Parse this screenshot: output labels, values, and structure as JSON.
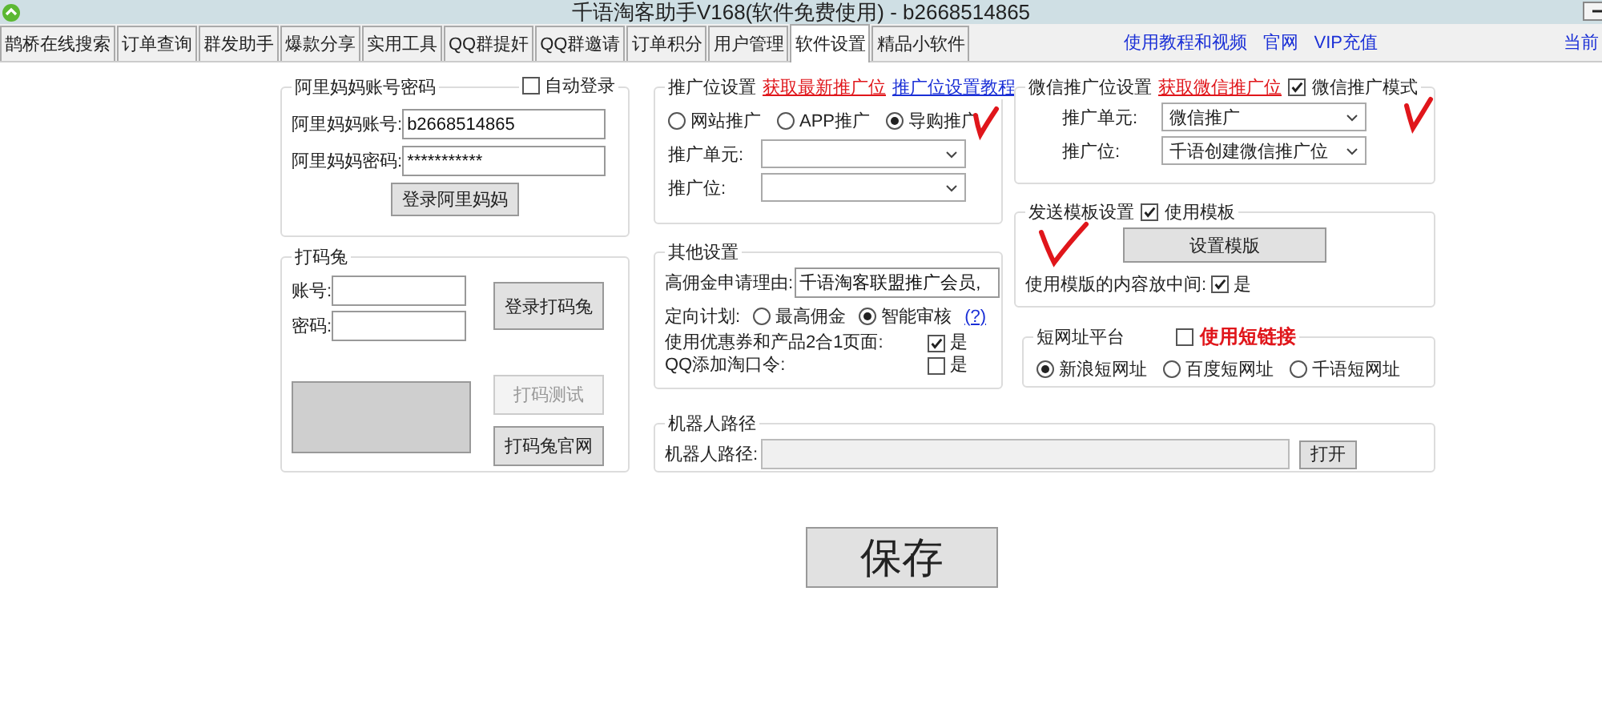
{
  "window": {
    "title": "千语淘客助手V168(软件免费使用) - b2668514865"
  },
  "tabs": [
    {
      "label": "鹊桥在线搜索",
      "selected": false
    },
    {
      "label": "订单查询",
      "selected": false
    },
    {
      "label": "群发助手",
      "selected": false
    },
    {
      "label": "爆款分享",
      "selected": false
    },
    {
      "label": "实用工具",
      "selected": false
    },
    {
      "label": "QQ群提奸",
      "selected": false
    },
    {
      "label": "QQ群邀请",
      "selected": false
    },
    {
      "label": "订单积分",
      "selected": false
    },
    {
      "label": "用户管理",
      "selected": false
    },
    {
      "label": "软件设置",
      "selected": true
    },
    {
      "label": "精品小软件",
      "selected": false
    }
  ],
  "links": [
    "使用教程和视频",
    "官网",
    "VIP充值"
  ],
  "status_text": "当前",
  "alimama": {
    "title": "阿里妈妈账号密码",
    "auto_login": {
      "label": "自动登录",
      "checked": false
    },
    "fields": [
      {
        "label": "阿里妈妈账号:",
        "value": "b2668514865"
      },
      {
        "label": "阿里妈妈密码:",
        "value": "***********"
      }
    ],
    "button": "登录阿里妈妈"
  },
  "damatu": {
    "title": "打码兔",
    "fields": [
      {
        "label": "账号:"
      },
      {
        "label": "密码:"
      }
    ],
    "login_button": "登录打码兔",
    "test_button": {
      "label": "打码测试",
      "disabled": true
    },
    "site_button": "打码兔官网"
  },
  "promo": {
    "title": "推广位设置",
    "links": [
      {
        "label": "获取最新推广位",
        "kind": "alert"
      },
      {
        "label": "推广位设置教程",
        "kind": "plain"
      }
    ],
    "modes": [
      {
        "label": "网站推广",
        "selected": false
      },
      {
        "label": "APP推广",
        "selected": false
      },
      {
        "label": "导购推广",
        "selected": true
      }
    ],
    "selects": [
      {
        "label": "推广单元:"
      },
      {
        "label": "推广位:"
      }
    ]
  },
  "other": {
    "title": "其他设置",
    "reason": {
      "label": "高佣金申请理由:",
      "value": "千语淘客联盟推广会员,"
    },
    "plan": {
      "label": "定向计划:",
      "options": [
        {
          "label": "最高佣金",
          "selected": false
        },
        {
          "label": "智能审核",
          "selected": true
        }
      ],
      "help": "(?)"
    },
    "checks": [
      {
        "label": "使用优惠券和产品2合1页面:",
        "option": "是",
        "checked": true
      },
      {
        "label": "QQ添加淘口令:",
        "option": "是",
        "checked": false
      }
    ]
  },
  "wechat": {
    "title": "微信推广位设置",
    "link": "获取微信推广位",
    "mode": {
      "label": "微信推广模式",
      "checked": true
    },
    "selects": [
      {
        "label": "推广单元:",
        "value": "微信推广"
      },
      {
        "label": "推广位:",
        "value": "千语创建微信推广位"
      }
    ]
  },
  "template": {
    "title": "发送模板设置",
    "use": {
      "label": "使用模板",
      "checked": true
    },
    "button": "设置模版",
    "center": {
      "label": "使用模版的内容放中间:",
      "option": "是",
      "checked": true
    }
  },
  "short_url": {
    "title": "短网址平台",
    "use": {
      "label": "使用短链接",
      "checked": false
    },
    "options": [
      {
        "label": "新浪短网址",
        "selected": true
      },
      {
        "label": "百度短网址",
        "selected": false
      },
      {
        "label": "千语短网址",
        "selected": false
      }
    ]
  },
  "robot": {
    "title": "机器人路径",
    "label": "机器人路径:",
    "button": "打开"
  },
  "save_button": "保存"
}
